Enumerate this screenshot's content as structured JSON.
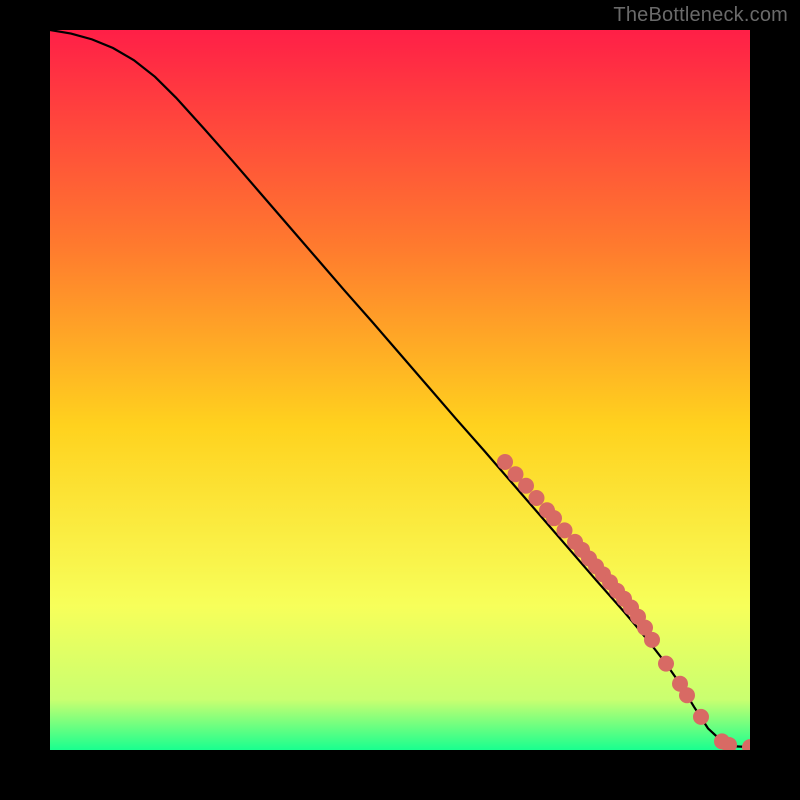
{
  "attribution": "TheBottleneck.com",
  "colors": {
    "page_bg": "#000000",
    "attribution_text": "#6a6a6a",
    "gradient_top": "#ff1f47",
    "gradient_mid_upper": "#ff7a2e",
    "gradient_mid": "#ffd21e",
    "gradient_mid_lower": "#f7ff5a",
    "gradient_near_bottom": "#c9ff70",
    "gradient_bottom": "#19ff8f",
    "curve": "#000000",
    "points_fill": "#d86a64",
    "points_stroke": "#d86a64"
  },
  "chart_data": {
    "type": "line",
    "title": "",
    "xlabel": "",
    "ylabel": "",
    "xlim": [
      0,
      100
    ],
    "ylim": [
      0,
      100
    ],
    "grid": false,
    "legend": false,
    "series": [
      {
        "name": "curve",
        "kind": "line",
        "x": [
          0,
          3,
          6,
          9,
          12,
          15,
          18,
          22,
          26,
          30,
          34,
          38,
          42,
          46,
          50,
          54,
          58,
          62,
          66,
          70,
          74,
          78,
          82,
          84,
          86,
          88,
          90,
          92,
          94,
          96,
          98,
          100
        ],
        "y": [
          100,
          99.5,
          98.7,
          97.5,
          95.8,
          93.5,
          90.6,
          86.3,
          81.9,
          77.4,
          72.9,
          68.4,
          63.9,
          59.5,
          55.0,
          50.5,
          46.0,
          41.6,
          37.1,
          32.6,
          28.1,
          23.6,
          19.2,
          16.9,
          14.5,
          12.0,
          9.2,
          6.0,
          3.0,
          1.2,
          0.5,
          0.4
        ]
      },
      {
        "name": "points",
        "kind": "scatter",
        "x": [
          65,
          66.5,
          68,
          69.5,
          71,
          72,
          73.5,
          75,
          76,
          77,
          78,
          79,
          80,
          81,
          82,
          83,
          84,
          85,
          86,
          88,
          90,
          91,
          93,
          96,
          97,
          100
        ],
        "y": [
          40.0,
          38.3,
          36.7,
          35.0,
          33.3,
          32.2,
          30.5,
          28.9,
          27.8,
          26.6,
          25.5,
          24.4,
          23.3,
          22.1,
          21.0,
          19.8,
          18.5,
          17.0,
          15.3,
          12.0,
          9.2,
          7.6,
          4.6,
          1.2,
          0.7,
          0.4
        ]
      }
    ]
  }
}
